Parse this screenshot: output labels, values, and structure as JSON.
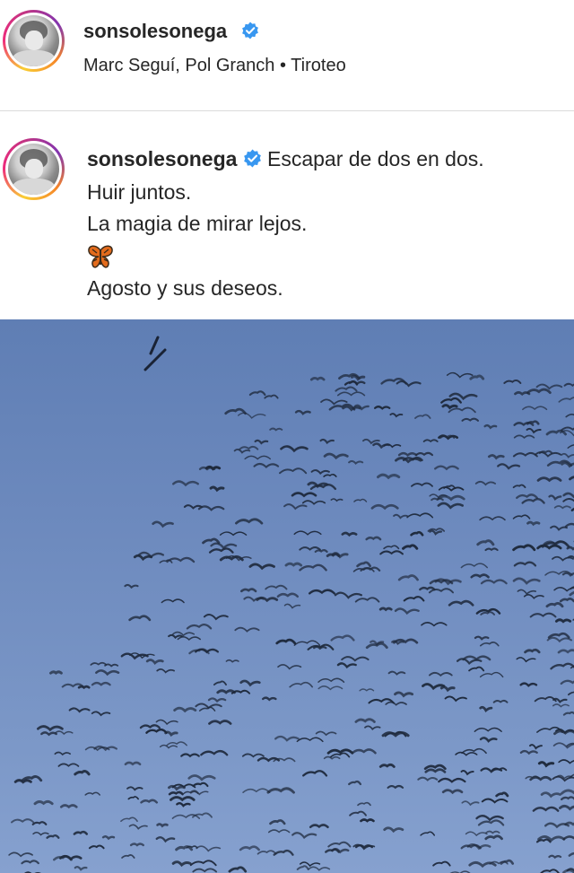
{
  "header": {
    "username": "sonsolesonega",
    "subline": "Marc Seguí, Pol Granch • Tiroteo"
  },
  "caption": {
    "username": "sonsolesonega",
    "first_line": "Escapar de dos en dos.",
    "lines": [
      "Huir juntos.",
      "La magia de mirar lejos."
    ],
    "emoji": "butterfly",
    "last_line": "Agosto y sus deseos."
  },
  "media": {
    "subject": "flock of birds",
    "sky_color": "#6f8cbf"
  },
  "colors": {
    "verified_blue": "#3897f0",
    "text": "#262626",
    "divider": "#dbdbdb"
  }
}
